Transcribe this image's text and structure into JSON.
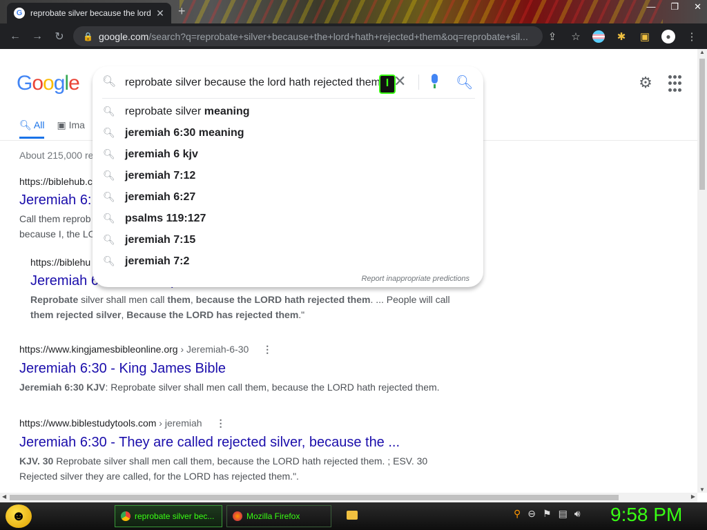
{
  "browser": {
    "tab_title": "reprobate silver because the lord",
    "tab_close": "✕",
    "new_tab": "+",
    "window_controls": [
      "—",
      "❐",
      "✕"
    ],
    "url_host": "google.com",
    "url_rest": "/search?q=reprobate+silver+because+the+lord+hath+rejected+them&oq=reprobate+sil..."
  },
  "header": {
    "logo_letters": [
      "G",
      "o",
      "o",
      "g",
      "l",
      "e"
    ],
    "logo_colors": [
      "#4285f4",
      "#ea4335",
      "#fbbc05",
      "#4285f4",
      "#34a853",
      "#ea4335"
    ]
  },
  "search": {
    "query": "reprobate silver because the lord hath rejected them",
    "suggestions": [
      {
        "plain": "reprobate silver ",
        "bold": "meaning"
      },
      {
        "plain": "",
        "bold": "jeremiah 6:30 meaning"
      },
      {
        "plain": "",
        "bold": "jeremiah 6 kjv"
      },
      {
        "plain": "",
        "bold": "jeremiah 7:12"
      },
      {
        "plain": "",
        "bold": "jeremiah 6:27"
      },
      {
        "plain": "",
        "bold": "psalms 119:127"
      },
      {
        "plain": "",
        "bold": "jeremiah 7:15"
      },
      {
        "plain": "",
        "bold": "jeremiah 7:2"
      }
    ],
    "report_text": "Report inappropriate predictions"
  },
  "tabs": {
    "all": "All",
    "images": "Ima"
  },
  "stats": "About 215,000 re",
  "results": [
    {
      "cite": "https://biblehub.c",
      "path": "",
      "title": "Jeremiah 6:",
      "snippet_1": "Call them reprob",
      "snippet_2": "because I, the LO"
    },
    {
      "cite": "https://biblehu",
      "path": "",
      "title": "Jeremiah 6:30 NLT: Reprobate silver shall men call them ...",
      "snippet_html": "<b>Reprobate</b> silver shall men call <b>them</b>, <b>because the LORD hath rejected them</b>. ... People will call <b>them rejected silver</b>, <b>Because the LORD has rejected them</b>.\""
    },
    {
      "cite": "https://www.kingjamesbibleonline.org",
      "path": " › Jeremiah-6-30",
      "title": "Jeremiah 6:30 - King James Bible",
      "snippet_html": "<b>Jeremiah 6:30 KJV</b>: Reprobate silver shall men call them, because the LORD hath rejected them."
    },
    {
      "cite": "https://www.biblestudytools.com",
      "path": " › jeremiah",
      "title": "Jeremiah 6:30 - They are called rejected silver, because the ...",
      "snippet_html": "<b>KJV. 30</b> Reprobate silver shall men call them, because the LORD hath rejected them. ; ESV. 30<br>Rejected silver they are called, for the LORD has rejected them.\"."
    }
  ],
  "taskbar": {
    "chrome_task": "reprobate silver bec...",
    "firefox_task": "Mozilla Firefox",
    "clock": "9:58 PM"
  }
}
